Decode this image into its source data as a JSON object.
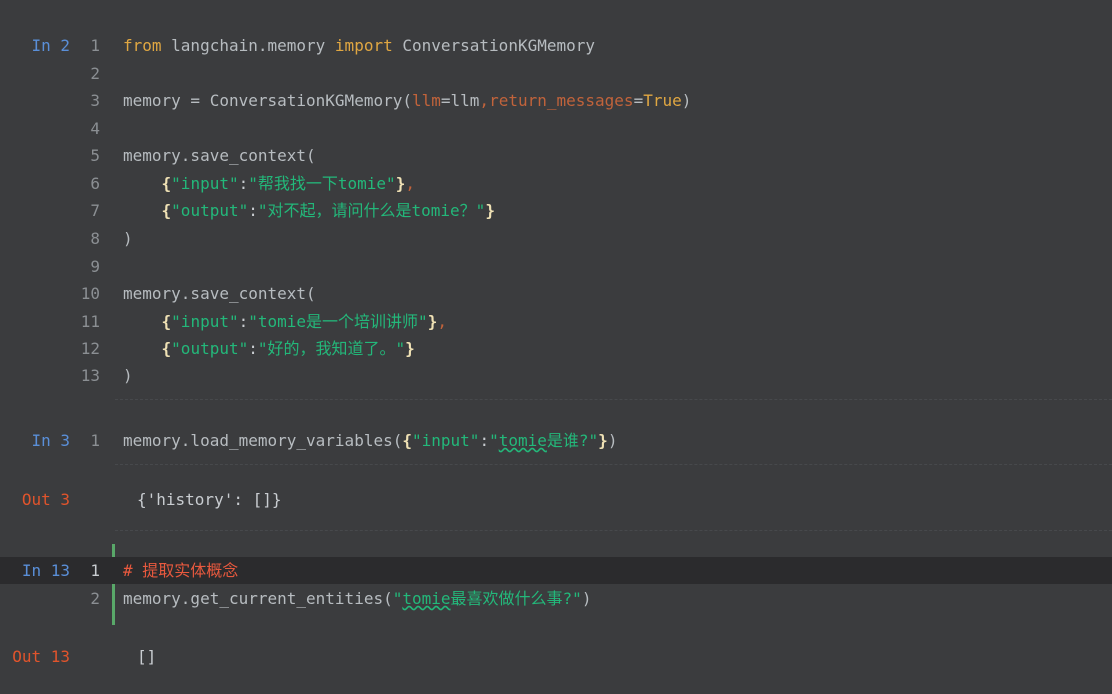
{
  "cells": {
    "in2": {
      "prompt": "In 2",
      "lines": [
        {
          "no": "1"
        },
        {
          "no": "2"
        },
        {
          "no": "3"
        },
        {
          "no": "4"
        },
        {
          "no": "5"
        },
        {
          "no": "6"
        },
        {
          "no": "7"
        },
        {
          "no": "8"
        },
        {
          "no": "9"
        },
        {
          "no": "10"
        },
        {
          "no": "11"
        },
        {
          "no": "12"
        },
        {
          "no": "13"
        }
      ],
      "tokens": {
        "l1_from": "from",
        "l1_mod": " langchain.memory ",
        "l1_import": "import",
        "l1_cls": " ConversationKGMemory",
        "l3_a": "memory = ConversationKGMemory(",
        "l3_llm": "llm",
        "l3_eq1": "=llm",
        "l3_comma": ",",
        "l3_rm": "return_messages",
        "l3_eq2": "=",
        "l3_true": "True",
        "l3_close": ")",
        "l5": "memory.save_context(",
        "l6_pre": "    ",
        "l6_ob": "{",
        "l6_key": "\"input\"",
        "l6_colon": ":",
        "l6_val": "\"帮我找一下tomie\"",
        "l6_cb": "}",
        "l6_comma": ",",
        "l7_pre": "    ",
        "l7_ob": "{",
        "l7_key": "\"output\"",
        "l7_colon": ":",
        "l7_val": "\"对不起，请问什么是tomie？\"",
        "l7_cb": "}",
        "l8": ")",
        "l10": "memory.save_context(",
        "l11_pre": "    ",
        "l11_ob": "{",
        "l11_key": "\"input\"",
        "l11_colon": ":",
        "l11_val": "\"tomie是一个培训讲师\"",
        "l11_cb": "}",
        "l11_comma": ",",
        "l12_pre": "    ",
        "l12_ob": "{",
        "l12_key": "\"output\"",
        "l12_colon": ":",
        "l12_val": "\"好的，我知道了。\"",
        "l12_cb": "}",
        "l13": ")"
      }
    },
    "in3": {
      "prompt": "In 3",
      "line_no": "1",
      "t_a": "memory.load_memory_variables(",
      "t_ob": "{",
      "t_key": "\"input\"",
      "t_colon": ":",
      "t_q1": "\"",
      "t_tomie": "tomie",
      "t_rest": "是谁?\"",
      "t_cb": "}",
      "t_close": ")"
    },
    "out3": {
      "prompt": "Out 3",
      "value": "{'history': []}"
    },
    "in13": {
      "prompt": "In 13",
      "line1_no": "1",
      "line2_no": "2",
      "comment": "# 提取实体概念",
      "t_a": "memory.get_current_entities(",
      "t_q1": "\"",
      "t_tomie": "tomie",
      "t_rest": "最喜欢做什么事?\"",
      "t_close": ")"
    },
    "out13": {
      "prompt": "Out 13",
      "value": "[]"
    }
  },
  "colors": {
    "background": "#3b3c3e",
    "keyword": "#e0a742",
    "string": "#23b87a",
    "param": "#c1633b",
    "comment": "#e8593e",
    "prompt_in": "#5a8fd8",
    "prompt_out": "#e0542c"
  }
}
